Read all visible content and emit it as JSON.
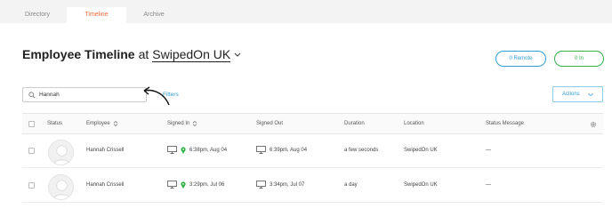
{
  "tabs": [
    {
      "label": "Directory"
    },
    {
      "label": "Timeline"
    },
    {
      "label": "Archive"
    }
  ],
  "header": {
    "title": "Employee Timeline",
    "at": "at",
    "company": "SwipedOn UK",
    "remote_button": "0 Remote",
    "in_button": "0 In"
  },
  "search": {
    "value": "Hannah",
    "placeholder": "Search"
  },
  "filters_label": "Filters",
  "actions_label": "Actions",
  "columns": {
    "status": "Status",
    "employee": "Employee",
    "signed_in": "Signed In",
    "signed_out": "Signed Out",
    "duration": "Duration",
    "location": "Location",
    "status_message": "Status Message"
  },
  "rows": [
    {
      "employee": "Hannah Crissell",
      "signed_in": "6:38pm, Aug 04",
      "signed_out": "6:39pm, Aug 04",
      "duration": "a few seconds",
      "location": "SwipedOn UK",
      "status_message": "—"
    },
    {
      "employee": "Hannah Crissell",
      "signed_in": "3:29pm, Jul 06",
      "signed_out": "3:34pm, Jul 07",
      "duration": "a day",
      "location": "SwipedOn UK",
      "status_message": "—"
    }
  ],
  "colors": {
    "accent_orange": "#f26b3a",
    "accent_blue": "#2f9fd6",
    "accent_green": "#33b24a"
  }
}
